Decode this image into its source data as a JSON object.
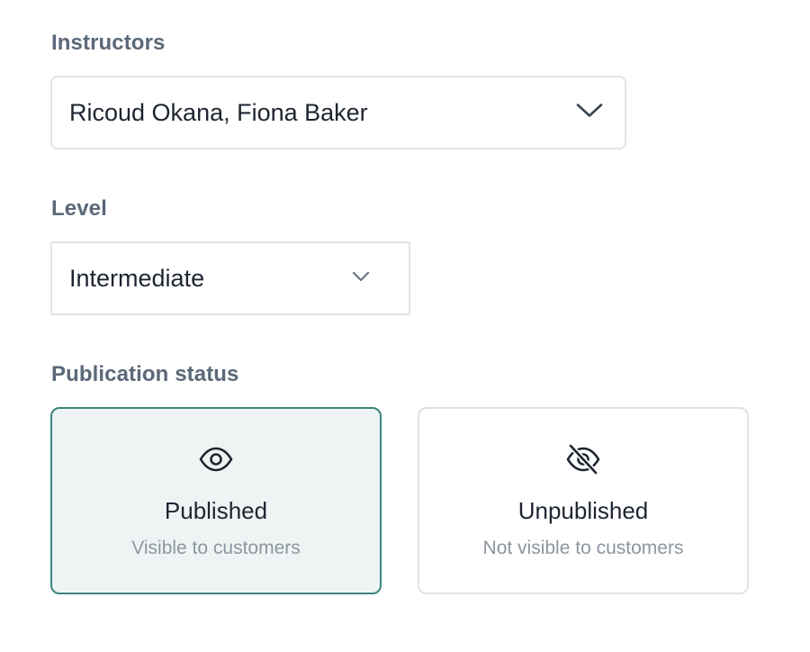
{
  "instructors": {
    "label": "Instructors",
    "value": "Ricoud Okana, Fiona Baker",
    "icon": "chevron-down-icon"
  },
  "level": {
    "label": "Level",
    "value": "Intermediate",
    "icon": "chevron-down-icon"
  },
  "publication_status": {
    "label": "Publication status",
    "selected": "Published",
    "options": [
      {
        "title": "Published",
        "subtitle": "Visible to customers",
        "icon": "eye-icon"
      },
      {
        "title": "Unpublished",
        "subtitle": "Not visible to customers",
        "icon": "eye-off-icon"
      }
    ]
  },
  "colors": {
    "accent": "#3d857c",
    "selected_background": "#eef4f4",
    "label": "#5b6878",
    "text": "#1e2530",
    "muted": "#8d969f"
  }
}
